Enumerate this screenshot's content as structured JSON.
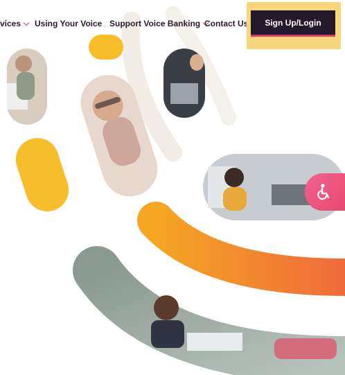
{
  "nav": {
    "services_label": "vices",
    "using_voice_label": "Using Your Voice",
    "support_label": "Support Voice Banking",
    "contact_label": "Contact Us",
    "login_label": "Sign Up/Login"
  },
  "colors": {
    "dark": "#25192c",
    "accent": "#d63a6b",
    "highlight": "#f6d77c",
    "yellow": "#f7bd2a",
    "orange": "#f28a2f",
    "pink": "#ec5b86"
  },
  "icons": {
    "accessibility": "wheelchair-icon",
    "dropdown": "chevron-down-icon"
  }
}
